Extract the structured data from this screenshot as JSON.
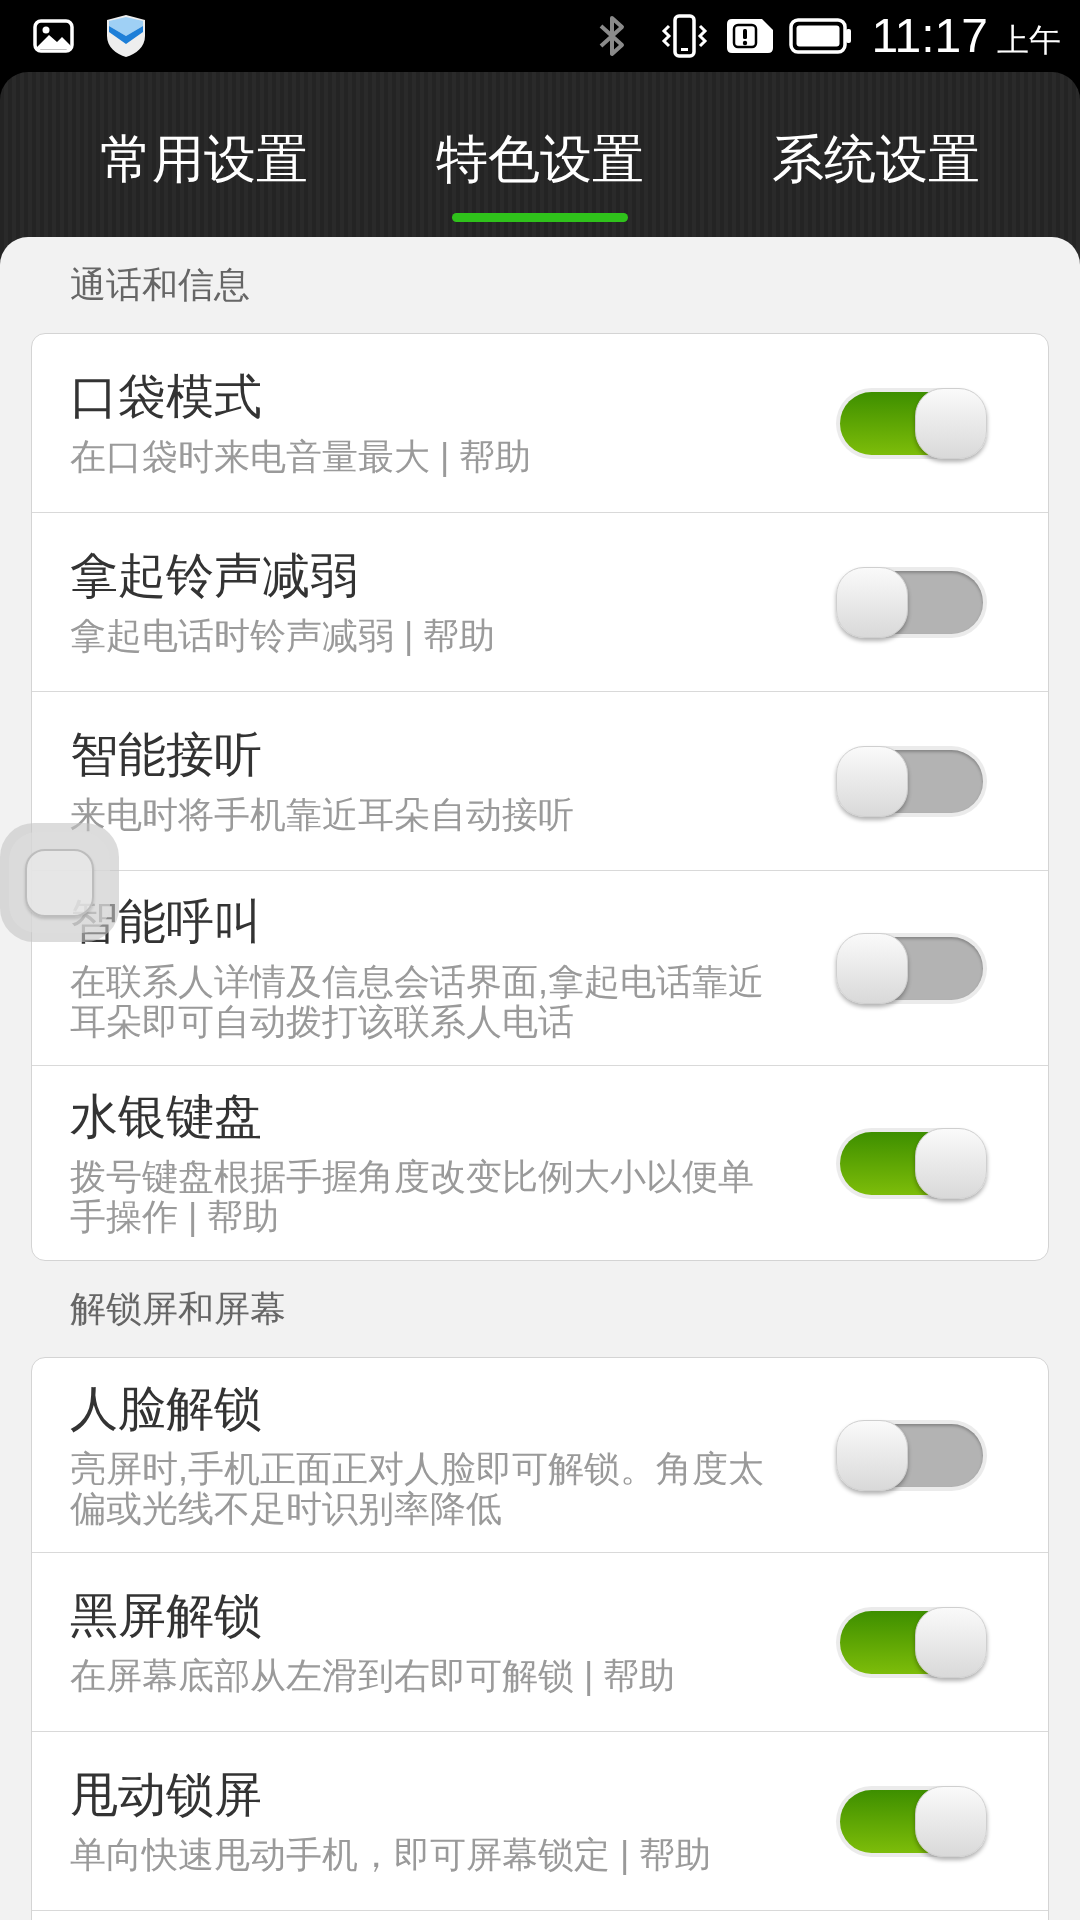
{
  "status_bar": {
    "time": "11:17",
    "period": "上午"
  },
  "tabs": [
    {
      "label": "常用设置",
      "selected": false
    },
    {
      "label": "特色设置",
      "selected": true
    },
    {
      "label": "系统设置",
      "selected": false
    }
  ],
  "sections": [
    {
      "header": "通话和信息",
      "items": [
        {
          "title": "口袋模式",
          "subtitle": "在口袋时来电音量最大 | 帮助",
          "on": true
        },
        {
          "title": "拿起铃声减弱",
          "subtitle": "拿起电话时铃声减弱 | 帮助",
          "on": false
        },
        {
          "title": "智能接听",
          "subtitle": "来电时将手机靠近耳朵自动接听",
          "on": false
        },
        {
          "title": "智能呼叫",
          "subtitle": "在联系人详情及信息会话界面,拿起电话靠近耳朵即可自动拨打该联系人电话",
          "on": false
        },
        {
          "title": "水银键盘",
          "subtitle": "拨号键盘根据手握角度改变比例大小以便单手操作 | 帮助",
          "on": true
        }
      ]
    },
    {
      "header": "解锁屏和屏幕",
      "items": [
        {
          "title": "人脸解锁",
          "subtitle": "亮屏时,手机正面正对人脸即可解锁。角度太偏或光线不足时识别率降低",
          "on": false
        },
        {
          "title": "黑屏解锁",
          "subtitle": "在屏幕底部从左滑到右即可解锁 | 帮助",
          "on": true
        },
        {
          "title": "甩动锁屏",
          "subtitle": "单向快速甩动手机，即可屏幕锁定 | 帮助",
          "on": true
        }
      ]
    }
  ]
}
